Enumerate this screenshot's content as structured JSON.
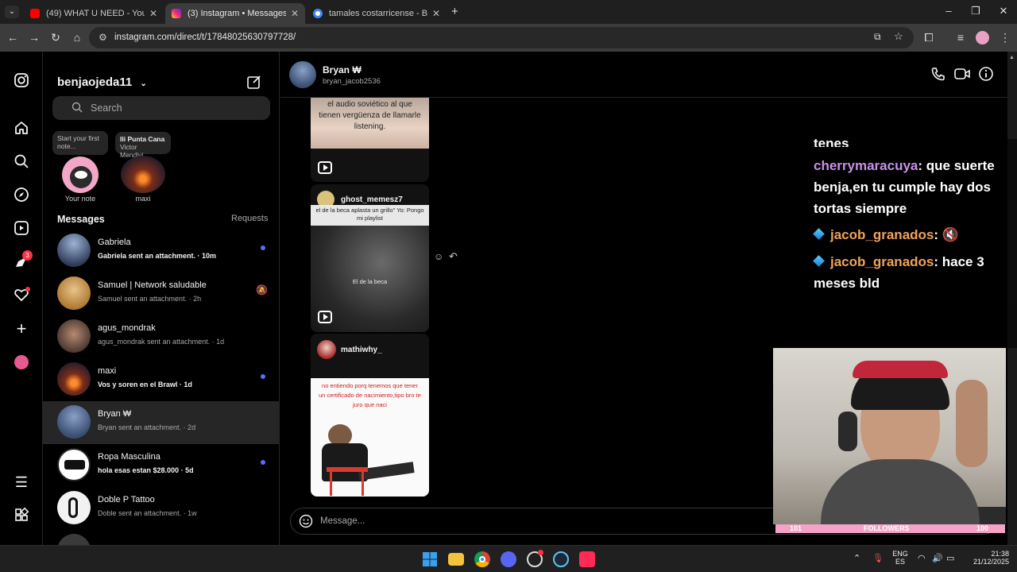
{
  "browser": {
    "tabs": [
      {
        "title": "(49) WHAT U NEED - YouTube",
        "color": "#ff0000"
      },
      {
        "title": "(3) Instagram • Messages",
        "color": "#d62976",
        "active": true
      },
      {
        "title": "tamales costarricense - Buscar c",
        "color": "#4285f4"
      }
    ],
    "url": "instagram.com/direct/t/17848025630797728/"
  },
  "sidebar": {
    "username": "benjaojeda11",
    "search_placeholder": "Search",
    "notes": {
      "own_bubble": "Start your first note...",
      "own_label": "Your note",
      "friend_bubble_title": "Punta Cana",
      "friend_bubble_artist": "Victor Mendivi...",
      "friend_label": "maxi"
    },
    "messages_header": "Messages",
    "requests_label": "Requests",
    "conversations": [
      {
        "name": "Gabriela",
        "preview": "Gabriela sent an attachment. · 10m",
        "unread": true
      },
      {
        "name": "Samuel | Network saludable",
        "preview": "Samuel sent an attachment. · 2h",
        "muted": true
      },
      {
        "name": "agus_mondrak",
        "preview": "agus_mondrak sent an attachment. · 1d"
      },
      {
        "name": "maxi",
        "preview": "Vos y soren en el Brawl · 1d",
        "unread": true
      },
      {
        "name": "Bryan ₩",
        "preview": "Bryan sent an attachment. · 2d",
        "selected": true
      },
      {
        "name": "Ropa Masculina",
        "preview": "hola esas estan $28.000 · 5d",
        "unread": true
      },
      {
        "name": "Doble P Tattoo",
        "preview": "Doble sent an attachment. · 1w"
      }
    ]
  },
  "rail": {
    "notifications_badge": "3"
  },
  "chat": {
    "name": "Bryan ₩",
    "handle": "bryan_jacob2536",
    "messages": [
      {
        "caption": "el audio soviético al que tienen vergüenza de llamarle listening."
      },
      {
        "sender": "ghost_memesz7",
        "top_text": "el de la beca aplasta un grillo\" Yo: Pongo mi playlist",
        "center_text": "El de la beca"
      },
      {
        "sender": "mathiwhy_",
        "caption": "no entiendo porq tenemos que tener un certificado de nacimiento,tipo bro te juro que naci"
      }
    ],
    "composer_placeholder": "Message..."
  },
  "overlay": {
    "chat": [
      {
        "text": "tenes"
      },
      {
        "user": "cherrymaracuya",
        "text": ": que suerte benja,en tu cumple hay dos tortas siempre"
      },
      {
        "user": "jacob_granados",
        "text": ": 🔇"
      },
      {
        "user": "jacob_granados",
        "text": ": hace 3 meses bld"
      }
    ],
    "follow_left": "101",
    "follow_label": "FOLLOWERS",
    "follow_right": "100"
  },
  "taskbar": {
    "lang_top": "ENG",
    "lang_bottom": "ES",
    "time": "21:38",
    "date": "21/12/2025"
  }
}
